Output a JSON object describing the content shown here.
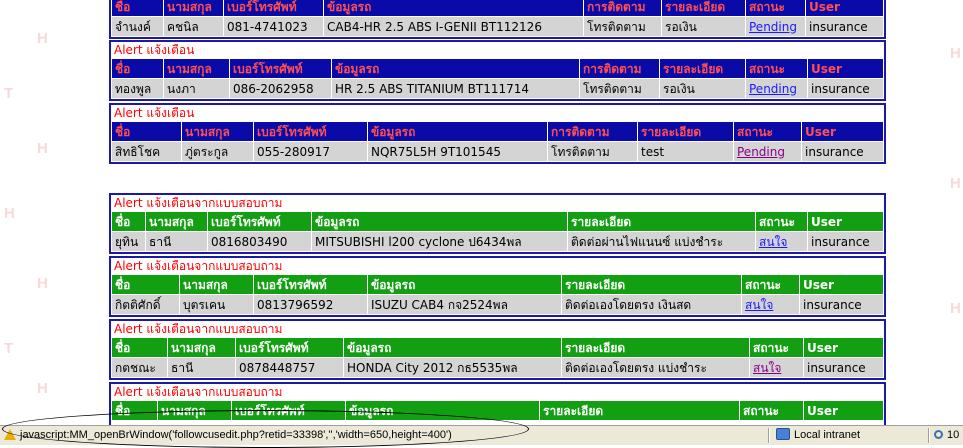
{
  "watermark": "H",
  "headers": {
    "blue": [
      "ชื่อ",
      "นามสกุล",
      "เบอร์โทรศัพท์",
      "ข้อมูลรถ",
      "การติดตาม",
      "รายละเอียด",
      "สถานะ",
      "User"
    ],
    "green": [
      "ชื่อ",
      "นามสกุล",
      "เบอร์โทรศัพท์",
      "ข้อมูลรถ",
      "รายละเอียด",
      "สถานะ",
      "User"
    ]
  },
  "alerts": [
    {
      "title": "",
      "row": [
        "จำนงค์",
        "คชนิล",
        "081-4741023",
        "CAB4-HR 2.5 ABS I-GENII BT112126",
        "โทรติดตาม",
        "รอเงิน",
        "Pending",
        "insurance"
      ]
    },
    {
      "title": "Alert แจ้งเตือน",
      "row": [
        "ทองพูล",
        "นงภา",
        "086-2062958",
        "HR 2.5 ABS TITANIUM BT111714",
        "โทรติดตาม",
        "รอเงิน",
        "Pending",
        "insurance"
      ]
    },
    {
      "title": "Alert แจ้งเตือน",
      "row": [
        "สิทธิโชค",
        "ภู่ตระกูล",
        "055-280917",
        "NQR75L5H 9T101545",
        "โทรติดตาม",
        "test",
        "Pending",
        "insurance"
      ]
    }
  ],
  "surveys": [
    {
      "title": "Alert แจ้งเตือนจากแบบสอบถาม",
      "row": [
        "ยุทิน",
        "ธานี",
        "0816803490",
        "MITSUBISHI l200 cyclone ป6434พล",
        "ติดต่อผ่านไฟแนนซ์ แบ่งชำระ",
        "สนใจ",
        "insurance"
      ]
    },
    {
      "title": "Alert แจ้งเตือนจากแบบสอบถาม",
      "row": [
        "กิตติศักดิ์",
        "บุตรเคน",
        "0813796592",
        "ISUZU CAB4 กจ2524พล",
        "ติดต่อเองโดยตรง เงินสด",
        "สนใจ",
        "insurance"
      ]
    },
    {
      "title": "Alert แจ้งเตือนจากแบบสอบถาม",
      "row": [
        "กตชณะ",
        "ธานี",
        "0878448757",
        "HONDA City 2012 กธ5535พล",
        "ติดต่อเองโดยตรง แบ่งชำระ",
        "สนใจ",
        "insurance"
      ]
    },
    {
      "title": "Alert แจ้งเตือนจากแบบสอบถาม",
      "row": []
    }
  ],
  "statusbar": {
    "text": "javascript:MM_openBrWindow('followcusedit.php?retid=33398','','width=650,height=400')",
    "zone": "Local intranet",
    "zoom": "10"
  },
  "colors": {
    "blue_header": "#0a0aa8",
    "green_header": "#12a012",
    "panel_border": "#1a1aa6",
    "title": "#ff0000",
    "link": "#1a1aff",
    "visited_link": "#8a008a"
  }
}
